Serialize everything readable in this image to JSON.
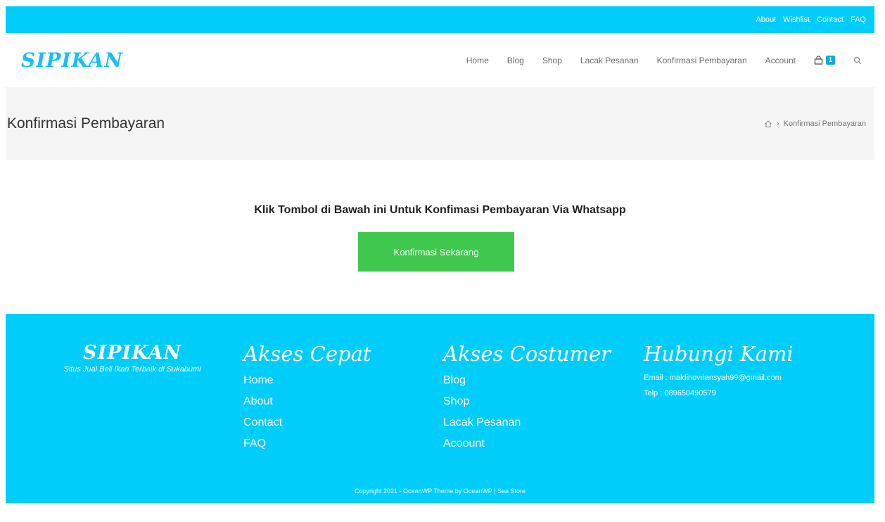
{
  "topbar": {
    "links": [
      "About",
      "Wishlist",
      "Contact",
      "FAQ"
    ]
  },
  "header": {
    "logo": "SIPIKAN",
    "nav": [
      "Home",
      "Blog",
      "Shop",
      "Lacak Pesanan",
      "Konfirmasi Pembayaran",
      "Account"
    ],
    "cart_count": "1",
    "icons": {
      "cart": "shopping-bag-icon",
      "search": "search-icon"
    }
  },
  "titlebar": {
    "title": "Konfirmasi Pembayaran",
    "breadcrumb_current": "Konfirmasi Pembayaran",
    "home_icon": "home-icon"
  },
  "content": {
    "heading": "Klik Tombol di Bawah ini Untuk Konfimasi Pembayaran Via Whatsapp",
    "button_label": "Konfirmasi Sekarang"
  },
  "footer": {
    "brand": {
      "logo": "SIPIKAN",
      "tagline": "Situs Jual Beli Ikan Terbaik di Sukabumi"
    },
    "akses_cepat": {
      "title": "Akses Cepat",
      "links": [
        "Home",
        "About",
        "Contact",
        "FAQ"
      ]
    },
    "akses_costumer": {
      "title": "Akses Costumer",
      "links": [
        "Blog",
        "Shop",
        "Lacak Pesanan",
        "Acoount"
      ]
    },
    "hubungi": {
      "title": "Hubungi Kami",
      "email": "Email : maldinovriansyah99@gmail.com",
      "telp": "Telp : 089650490579"
    },
    "copyright": "Copyright 2021 - OceanWP Theme by OceanWP | Sea Store"
  },
  "colors": {
    "brand": "#00cdf9",
    "button": "#3fc84d",
    "titlebar_bg": "#f5f5f5"
  }
}
